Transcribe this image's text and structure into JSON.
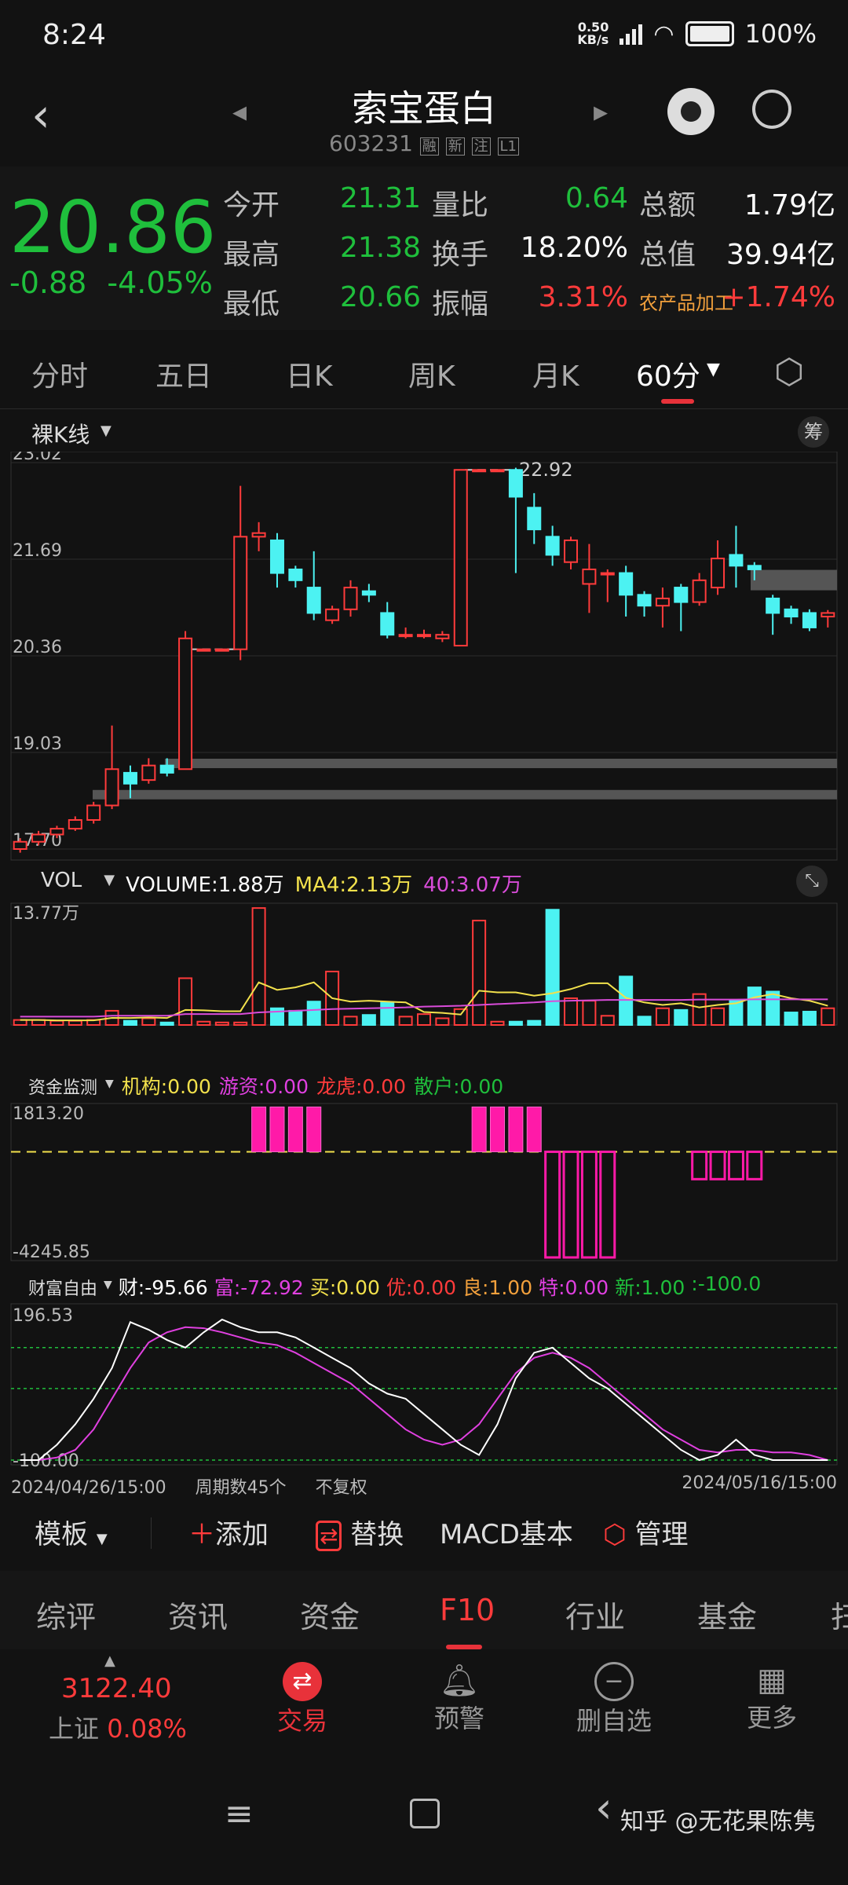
{
  "status": {
    "time": "8:24",
    "speed": "0.50\nKB/s",
    "battery": "100%"
  },
  "header": {
    "title": "索宝蛋白",
    "code": "603231",
    "tags": [
      "融",
      "新",
      "注",
      "L1"
    ]
  },
  "quote": {
    "price": "20.86",
    "change": "-0.88",
    "change_pct": "-4.05%",
    "rows": [
      {
        "l1": "今开",
        "v1": "21.31",
        "l2": "量比",
        "v2": "0.64",
        "l3": "总额",
        "v3": "1.79亿"
      },
      {
        "l1": "最高",
        "v1": "21.38",
        "l2": "换手",
        "v2": "18.20%",
        "l3": "总值",
        "v3": "39.94亿"
      },
      {
        "l1": "最低",
        "v1": "20.66",
        "l2": "振幅",
        "v2": "3.31%",
        "l3": "农产品加工",
        "v3": "+1.74%"
      }
    ]
  },
  "tabs": [
    "分时",
    "五日",
    "日K",
    "周K",
    "月K",
    "60分"
  ],
  "kline": {
    "label": "裸K线",
    "chip": "筹",
    "ticks": [
      "23.02",
      "21.69",
      "20.36",
      "19.03",
      "17.70"
    ],
    "high_label": "22.92",
    "candles": [
      [
        17.7,
        17.8,
        17.65,
        17.85
      ],
      [
        17.8,
        17.9,
        17.75,
        17.95
      ],
      [
        17.9,
        17.98,
        17.85,
        18.02
      ],
      [
        17.98,
        18.1,
        17.95,
        18.15
      ],
      [
        18.1,
        18.3,
        18.05,
        18.35
      ],
      [
        18.3,
        18.8,
        18.25,
        19.4
      ],
      [
        18.75,
        18.6,
        18.4,
        18.85
      ],
      [
        18.65,
        18.85,
        18.6,
        18.95
      ],
      [
        18.85,
        18.75,
        18.7,
        18.95
      ],
      [
        18.8,
        20.6,
        18.8,
        20.7
      ],
      [
        20.45,
        20.45,
        20.45,
        20.45
      ],
      [
        20.45,
        20.45,
        20.45,
        20.45
      ],
      [
        20.45,
        22.0,
        20.3,
        22.7
      ],
      [
        22.0,
        22.05,
        21.8,
        22.2
      ],
      [
        21.95,
        21.5,
        21.3,
        22.05
      ],
      [
        21.55,
        21.4,
        21.3,
        21.6
      ],
      [
        21.3,
        20.95,
        20.85,
        21.8
      ],
      [
        20.85,
        21.0,
        20.8,
        21.05
      ],
      [
        21.0,
        21.3,
        20.9,
        21.4
      ],
      [
        21.25,
        21.2,
        21.1,
        21.35
      ],
      [
        20.95,
        20.65,
        20.6,
        21.1
      ],
      [
        20.65,
        20.65,
        20.6,
        20.75
      ],
      [
        20.65,
        20.65,
        20.6,
        20.72
      ],
      [
        20.6,
        20.65,
        20.55,
        20.7
      ],
      [
        20.5,
        22.92,
        20.5,
        22.92
      ],
      [
        22.92,
        22.92,
        22.92,
        22.92
      ],
      [
        22.92,
        22.92,
        22.92,
        22.92
      ],
      [
        22.92,
        22.55,
        21.5,
        22.95
      ],
      [
        22.4,
        22.1,
        21.9,
        22.6
      ],
      [
        22.0,
        21.75,
        21.6,
        22.15
      ],
      [
        21.65,
        21.95,
        21.55,
        22.0
      ],
      [
        21.35,
        21.55,
        20.95,
        21.9
      ],
      [
        21.5,
        21.5,
        21.1,
        21.55
      ],
      [
        21.5,
        21.2,
        20.9,
        21.6
      ],
      [
        21.2,
        21.05,
        20.9,
        21.25
      ],
      [
        21.05,
        21.15,
        20.75,
        21.3
      ],
      [
        21.3,
        21.1,
        20.7,
        21.35
      ],
      [
        21.1,
        21.4,
        21.05,
        21.5
      ],
      [
        21.3,
        21.7,
        21.2,
        21.95
      ],
      [
        21.75,
        21.6,
        21.3,
        22.15
      ],
      [
        21.6,
        21.55,
        21.4,
        21.65
      ],
      [
        21.15,
        20.95,
        20.65,
        21.2
      ],
      [
        21.0,
        20.9,
        20.8,
        21.05
      ],
      [
        20.95,
        20.75,
        20.7,
        21.0
      ],
      [
        20.9,
        20.95,
        20.75,
        20.99
      ]
    ]
  },
  "volume": {
    "label": "VOL",
    "vol": "VOLUME:1.88万",
    "ma4": "MA4:2.13万",
    "ma40": "40:3.07万",
    "tick": "13.77万",
    "values": [
      0.6,
      0.6,
      0.5,
      0.5,
      0.6,
      1.7,
      0.5,
      0.8,
      0.3,
      5.6,
      0.4,
      0.3,
      0.3,
      14.0,
      2.0,
      1.7,
      2.8,
      6.4,
      1.0,
      1.2,
      2.7,
      1.0,
      1.3,
      0.8,
      1.9,
      12.5,
      0.4,
      0.4,
      0.5,
      13.8,
      3.2,
      2.9,
      1.1,
      5.8,
      1.0,
      2.0,
      1.8,
      3.7,
      2.0,
      3.0,
      4.5,
      4.0,
      1.5,
      1.6,
      2.0
    ],
    "ma4_line": [
      0.6,
      0.6,
      0.55,
      0.55,
      0.55,
      0.85,
      0.83,
      0.9,
      0.83,
      1.8,
      1.75,
      1.65,
      1.65,
      5.1,
      4.2,
      4.5,
      5.1,
      3.2,
      2.8,
      2.9,
      2.8,
      2.7,
      1.55,
      1.45,
      1.25,
      4.1,
      3.9,
      3.9,
      3.5,
      3.8,
      4.3,
      5.0,
      5.0,
      3.25,
      2.7,
      2.4,
      2.6,
      2.1,
      2.4,
      2.6,
      3.3,
      3.7,
      3.2,
      2.9,
      2.3
    ],
    "ma40_line": [
      1.0,
      1.0,
      1.0,
      1.0,
      1.0,
      1.1,
      1.1,
      1.1,
      1.1,
      1.3,
      1.3,
      1.3,
      1.3,
      1.5,
      1.6,
      1.7,
      1.8,
      1.9,
      1.95,
      2.0,
      2.05,
      2.1,
      2.2,
      2.25,
      2.3,
      2.4,
      2.5,
      2.6,
      2.7,
      2.85,
      2.9,
      2.95,
      3.0,
      3.0,
      3.0,
      3.0,
      3.0,
      3.05,
      3.05,
      3.05,
      3.07,
      3.07,
      3.07,
      3.07,
      3.07
    ]
  },
  "funds": {
    "label": "资金监测",
    "inst": "机构:0.00",
    "hot": "游资:0.00",
    "dragon": "龙虎:0.00",
    "retail": "散户:0.00",
    "top": "1813.20",
    "bottom": "-4245.85",
    "values": [
      0,
      0,
      0,
      0,
      0,
      0,
      0,
      0,
      0,
      0,
      0,
      0,
      0,
      1800,
      1800,
      1800,
      1800,
      0,
      0,
      0,
      0,
      0,
      0,
      0,
      0,
      1800,
      1800,
      1800,
      1800,
      -4245,
      -4245,
      -4245,
      -4245,
      0,
      0,
      0,
      0,
      -1100,
      -1100,
      -1100,
      -1100,
      0,
      0,
      0,
      0
    ]
  },
  "wealth": {
    "label": "财富自由",
    "cai": "财:-95.66",
    "fu": "富:-72.92",
    "mai": "买:0.00",
    "you": "优:0.00",
    "liang": "良:1.00",
    "te": "特:0.00",
    "xin": "新:1.00",
    "extra": ":-100.0",
    "top": "196.53",
    "bottom": "-100.00",
    "white": [
      -100,
      -100,
      -70,
      -30,
      20,
      80,
      170,
      155,
      135,
      120,
      150,
      175,
      160,
      150,
      150,
      140,
      120,
      100,
      80,
      50,
      30,
      20,
      -10,
      -40,
      -70,
      -90,
      -30,
      60,
      110,
      120,
      90,
      60,
      40,
      10,
      -20,
      -50,
      -80,
      -100,
      -90,
      -60,
      -90,
      -100,
      -100,
      -100,
      -100
    ],
    "pink": [
      -100,
      -100,
      -95,
      -80,
      -40,
      20,
      80,
      130,
      150,
      160,
      158,
      150,
      140,
      130,
      125,
      110,
      90,
      70,
      50,
      20,
      -10,
      -40,
      -60,
      -70,
      -60,
      -30,
      20,
      70,
      100,
      110,
      100,
      80,
      50,
      20,
      -10,
      -40,
      -60,
      -80,
      -85,
      -80,
      -80,
      -85,
      -85,
      -90,
      -100
    ]
  },
  "date_bar": {
    "start": "2024/04/26/15:00",
    "periods": "周期数45个",
    "adj": "不复权",
    "end": "2024/05/16/15:00"
  },
  "tools": {
    "template": "模板",
    "add": "添加",
    "replace": "替换",
    "macd": "MACD基本",
    "manage": "管理"
  },
  "bottom_tabs": [
    "综评",
    "资讯",
    "资金",
    "F10",
    "行业",
    "基金",
    "扫"
  ],
  "footer": {
    "index_val": "3122.40",
    "index_name": "上证",
    "index_pct": "0.08%",
    "trade": "交易",
    "alert": "预警",
    "delfav": "删自选",
    "more": "更多"
  },
  "watermark": "知乎 @无花果陈隽",
  "colors": {
    "up": "#ff3b3b",
    "down": "#4cf2f2",
    "green": "#1fbf3c",
    "accent": "#e8323a"
  }
}
